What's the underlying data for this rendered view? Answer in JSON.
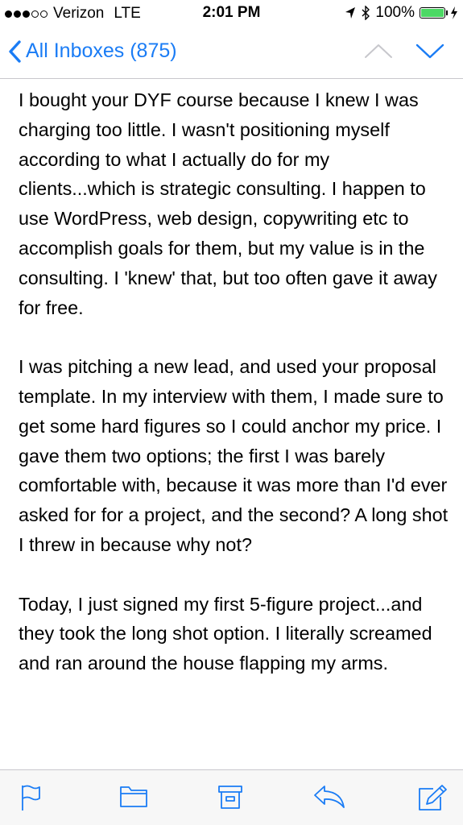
{
  "status_bar": {
    "signal": "●●●○○",
    "carrier": "Verizon",
    "network": "LTE",
    "time": "2:01 PM",
    "battery": "100%",
    "battery_level": 1.0,
    "icons": [
      "location-arrow-icon",
      "bluetooth-icon",
      "battery-icon",
      "charging-bolt-icon"
    ]
  },
  "nav": {
    "back_label": "All Inboxes (875)",
    "icons": [
      "chevron-left-icon",
      "chevron-up-icon",
      "chevron-down-icon"
    ]
  },
  "message": {
    "paragraphs": [
      "I bought your DYF course because I knew I was charging too little. I wasn't positioning myself according to what I actually do for my clients...which is strategic consulting. I happen to use WordPress, web design, copywriting etc to accomplish goals for them, but my value is in the consulting. I 'knew' that, but too often gave it away for free.",
      "I was pitching a new lead, and used your proposal template. In my interview with them, I made sure to get some hard figures so I could anchor my price. I gave them two options; the first I was barely comfortable with, because it was more than I'd ever asked for for a project, and the second? A long shot I threw in because why not?",
      "Today, I just signed my first 5-figure project...and they took the long shot option. I literally screamed and ran around the house flapping my arms."
    ]
  },
  "toolbar": {
    "icons": [
      "flag-icon",
      "folder-icon",
      "archive-icon",
      "reply-icon",
      "compose-icon"
    ]
  },
  "colors": {
    "accent": "#1a7cf5",
    "battery": "#4cd964",
    "disabled": "#c7c7cc"
  }
}
